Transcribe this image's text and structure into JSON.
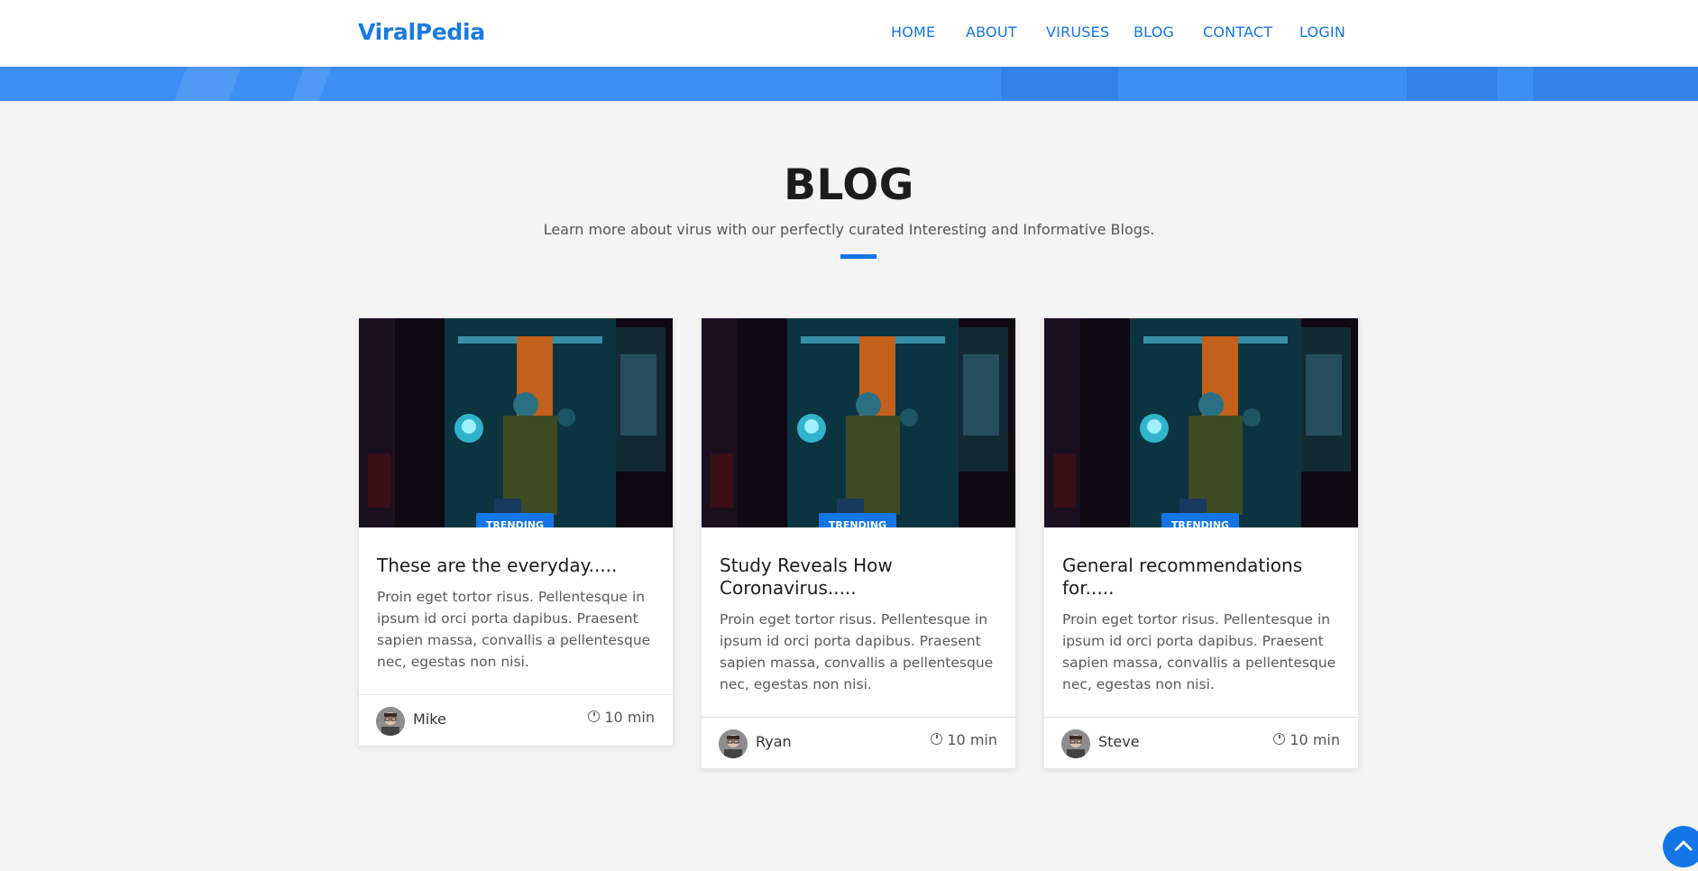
{
  "brand": "ViralPedia",
  "nav": [
    "HOME",
    "ABOUT",
    "VIRUSES",
    "BLOG",
    "CONTACT",
    "LOGIN"
  ],
  "section": {
    "title": "BLOG",
    "subtitle": "Learn more about virus with our perfectly curated Interesting and Informative Blogs."
  },
  "cards": [
    {
      "badge": "TRENDING",
      "title": "These are the everyday.....",
      "text": "Proin eget tortor risus. Pellentesque in ipsum id orci porta dapibus. Praesent sapien massa, convallis a pellentesque nec, egestas non nisi.",
      "author": "Mike",
      "time": "10 min"
    },
    {
      "badge": "TRENDING",
      "title": "Study Reveals How Coronavirus.....",
      "text": "Proin eget tortor risus. Pellentesque in ipsum id orci porta dapibus. Praesent sapien massa, convallis a pellentesque nec, egestas non nisi.",
      "author": "Ryan",
      "time": "10 min"
    },
    {
      "badge": "TRENDING",
      "title": "General recommendations for.....",
      "text": "Proin eget tortor risus. Pellentesque in ipsum id orci porta dapibus. Praesent sapien massa, convallis a pellentesque nec, egestas non nisi.",
      "author": "Steve",
      "time": "10 min"
    }
  ],
  "colors": {
    "accent": "#1376e6",
    "hero": "#3d8ff5",
    "background": "#f4f4f4"
  },
  "icons": {
    "clock": "clock-icon",
    "back_to_top": "chevron-up-icon"
  }
}
